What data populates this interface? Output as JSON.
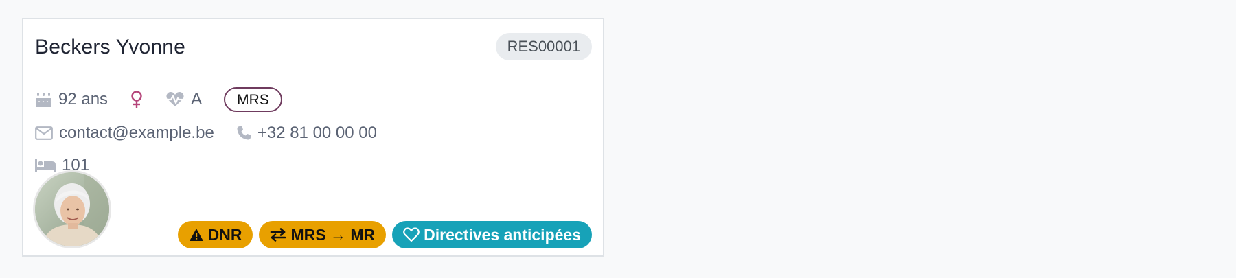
{
  "resident": {
    "name": "Beckers Yvonne",
    "reference": "RES00001",
    "age": "92 ans",
    "blood_type": "A",
    "facility_tag": "MRS",
    "email": "contact@example.be",
    "phone": "+32 81 00 00 00",
    "room": "101"
  },
  "badges": {
    "dnr": "DNR",
    "transfer": "MRS → MR",
    "directives": "Directives anticipées"
  },
  "icons": {
    "age": "birthday-cake-icon",
    "gender": "female-icon",
    "blood": "heartbeat-icon",
    "email": "envelope-icon",
    "phone": "phone-icon",
    "room": "bed-icon",
    "dnr": "warning-triangle-icon",
    "transfer": "exchange-arrows-icon",
    "directives": "heart-outline-icon"
  },
  "colors": {
    "warning_badge": "#e8a000",
    "info_badge": "#17a2b8",
    "female_symbol": "#b5457a",
    "facility_pill_border": "#6f3b5e",
    "reference_badge": "#e9ecef"
  }
}
